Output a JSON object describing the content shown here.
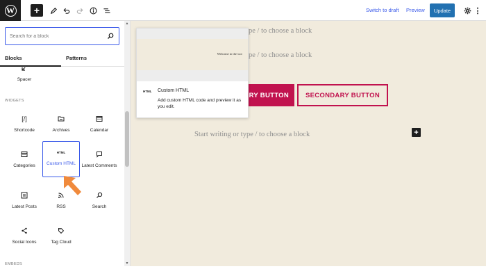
{
  "topbar": {
    "logo_letter": "W",
    "add_label": "+",
    "switch_to_draft": "Switch to draft",
    "preview": "Preview",
    "update": "Update",
    "more_dots": "⋮"
  },
  "inserter": {
    "search_placeholder": "Search for a block",
    "tabs": [
      {
        "label": "Blocks",
        "active": true
      },
      {
        "label": "Patterns",
        "active": false
      }
    ],
    "top_item": {
      "label": "Spacer",
      "icon": "spacer-icon"
    },
    "widgets_title": "WIDGETS",
    "widgets": [
      {
        "label": "Shortcode",
        "icon": "shortcode-icon",
        "glyph": "[/]"
      },
      {
        "label": "Archives",
        "icon": "archives-icon",
        "glyph": "📁"
      },
      {
        "label": "Calendar",
        "icon": "calendar-icon",
        "glyph": "▦"
      },
      {
        "label": "Categories",
        "icon": "categories-icon",
        "glyph": "▦"
      },
      {
        "label": "Custom HTML",
        "icon": "html-icon",
        "glyph": "HTML",
        "selected": true
      },
      {
        "label": "Latest Comments",
        "icon": "comment-icon",
        "glyph": "▭"
      },
      {
        "label": "Latest Posts",
        "icon": "latest-posts-icon",
        "glyph": "▤"
      },
      {
        "label": "RSS",
        "icon": "rss-icon",
        "glyph": "⌇"
      },
      {
        "label": "Search",
        "icon": "search-icon",
        "glyph": "⚲"
      },
      {
        "label": "Social Icons",
        "icon": "share-icon",
        "glyph": "<"
      },
      {
        "label": "Tag Cloud",
        "icon": "tag-icon",
        "glyph": "◇"
      }
    ],
    "embeds_title": "EMBEDS"
  },
  "preview": {
    "sample_text": "Welcome to the wor",
    "icon_label": "HTML",
    "title": "Custom HTML",
    "description": "Add custom HTML code and preview it as you edit."
  },
  "canvas": {
    "placeholder_partial": "pe / to choose a block",
    "placeholder_full": "Start writing or type / to choose a block",
    "primary_button": "RY BUTTON",
    "secondary_button": "SECONDARY BUTTON",
    "inline_add": "+"
  },
  "colors": {
    "accent": "#3858e9",
    "update_bg": "#2271b1",
    "brand": "#c1124e",
    "canvas_bg": "#f1ebdd",
    "arrow": "#f08a3c"
  }
}
